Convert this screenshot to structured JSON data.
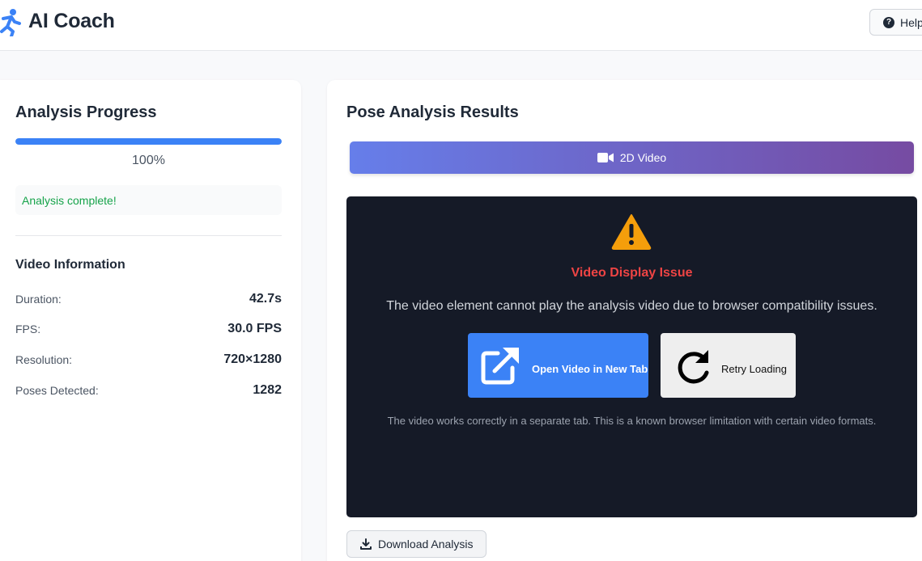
{
  "app": {
    "title": "AI Coach",
    "help_label": "Help"
  },
  "progress": {
    "title": "Analysis Progress",
    "percent_value": 100,
    "percent_label": "100%",
    "status": "Analysis complete!"
  },
  "video_info": {
    "title": "Video Information",
    "rows": [
      {
        "label": "Duration:",
        "value": "42.7s"
      },
      {
        "label": "FPS:",
        "value": "30.0 FPS"
      },
      {
        "label": "Resolution:",
        "value": "720×1280"
      },
      {
        "label": "Poses Detected:",
        "value": "1282"
      }
    ]
  },
  "results": {
    "title": "Pose Analysis Results",
    "tab_label": "2D Video",
    "issue_title": "Video Display Issue",
    "issue_description": "The video element cannot play the analysis video due to browser compatibility issues.",
    "open_button_label": "Open Video in New Tab",
    "retry_button_label": "Retry Loading",
    "note": "The video works correctly in a separate tab. This is a known browser limitation with certain video formats.",
    "download_label": "Download Analysis"
  },
  "colors": {
    "accent_blue": "#3b82f6",
    "success_green": "#16a34a",
    "error_red": "#ef4444",
    "warning_orange": "#f59e0b",
    "gradient_start": "#667eea",
    "gradient_end": "#764ba2",
    "video_bg": "#151a27"
  },
  "icons": {
    "logo": "running-person-icon",
    "help": "question-circle-icon",
    "tab": "video-camera-icon",
    "warning": "warning-triangle-icon",
    "open": "external-link-icon",
    "retry": "redo-icon",
    "download": "download-icon"
  }
}
